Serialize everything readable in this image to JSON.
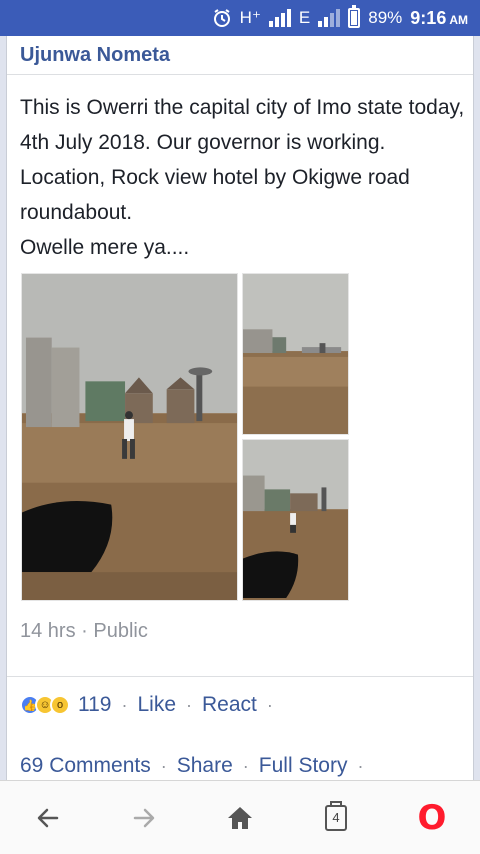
{
  "status_bar": {
    "network": "H⁺",
    "network2": "E",
    "battery": "89%",
    "time": "9:16",
    "ampm": "AM"
  },
  "post": {
    "author": "Ujunwa Nometa",
    "text_lines": [
      "This is Owerri the capital city of Imo state today,  4th July 2018. Our governor is working. Location, Rock view hotel by Okigwe road roundabout.",
      "Owelle mere ya...."
    ],
    "time": "14 hrs",
    "privacy": "Public",
    "photos_count": 3
  },
  "reactions": {
    "icons": [
      "like",
      "haha",
      "wow"
    ],
    "count": "119",
    "like_label": "Like",
    "react_label": "React"
  },
  "comments": {
    "comments_label": "69 Comments",
    "share_label": "Share",
    "full_story_label": "Full Story"
  },
  "separator": "·",
  "browser_nav": {
    "tab_count": "4",
    "icons": [
      "back-arrow-icon",
      "forward-arrow-icon",
      "home-icon",
      "tabs-icon",
      "opera-icon"
    ],
    "opera_glyph": "O",
    "accent": "#ff1b2d"
  },
  "colors": {
    "status_bar": "#3b5cb8",
    "link": "#3b5998",
    "meta": "#90949c"
  }
}
